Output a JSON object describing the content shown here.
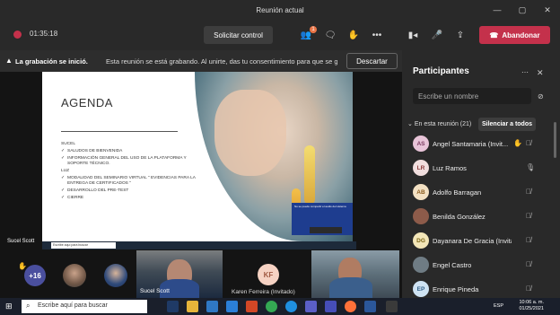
{
  "window": {
    "title": "Reunión actual",
    "controls": [
      "—",
      "▢",
      "✕"
    ]
  },
  "toolbar": {
    "timer": "01:35:18",
    "request_control_label": "Solicitar control",
    "participants_badge": "1",
    "leave_label": "Abandonar"
  },
  "banner": {
    "title": "La grabación se inició.",
    "text": "Esta reunión se está grabando. Al unirte, das tu consentimiento para que se gr...",
    "dismiss_label": "Descartar"
  },
  "slide": {
    "title": "AGENDA",
    "sections": [
      {
        "heading": "SUCEL",
        "items": [
          "SALUDOS DE BIENVENIDA",
          "INFORMACIÓN GENERAL DEL USO DE LA PLATAFORMA Y SOPORTE TÉCNICO."
        ]
      },
      {
        "heading": "LUZ",
        "items": [
          "MODALIDAD DEL SEMINARIO VIRTUAL \" EVIDENCIAS PARA LA ENTREGA DE CERTIFICADOS \"",
          "DESARROLLO DEL PRE-TEST",
          "CIERRE"
        ]
      }
    ],
    "popup_text": "No se puede compartir el audio del sistema",
    "taskbar_search": "Escribe aquí para buscar"
  },
  "presenter_name": "Sucel Scott",
  "video_strip": {
    "overflow_count": "+16",
    "tile_names": [
      "Sucel Scott",
      "Karen Ferreira (Invitado)"
    ],
    "kf_initials": "KF"
  },
  "panel": {
    "title": "Participantes",
    "invite_placeholder": "Escribe un nombre",
    "section_label": "En esta reunión (21)",
    "mute_all_label": "Silenciar a todos",
    "participants": [
      {
        "initials": "AS",
        "name": "Angel Santamaria (Invit...",
        "hand": true,
        "avatar_color": "#e8c4d8",
        "text_color": "#7a3a5f"
      },
      {
        "initials": "LR",
        "name": "Luz Ramos",
        "hand": false,
        "avatar_color": "#f1dede",
        "text_color": "#8b3a3a"
      },
      {
        "initials": "AB",
        "name": "Adolfo Barragan",
        "hand": false,
        "avatar_color": "#f3e1c3",
        "text_color": "#8a5a1c"
      },
      {
        "initials": "",
        "name": "Benilda González",
        "hand": false,
        "avatar_color": "#8d5b4a",
        "text_color": "#fff"
      },
      {
        "initials": "DG",
        "name": "Dayanara De Gracia (Invita...",
        "hand": false,
        "avatar_color": "#f3e6b8",
        "text_color": "#7a6415"
      },
      {
        "initials": "",
        "name": "Engel Castro",
        "hand": false,
        "avatar_color": "#6f7c84",
        "text_color": "#fff"
      },
      {
        "initials": "EP",
        "name": "Enrique Pineda",
        "hand": false,
        "avatar_color": "#cfe3f3",
        "text_color": "#2f5e86"
      }
    ]
  },
  "taskbar": {
    "search_placeholder": "Escribe aquí para buscar",
    "language": "ESP",
    "time": "10:06 a. m.",
    "date": "01/25/2021"
  }
}
